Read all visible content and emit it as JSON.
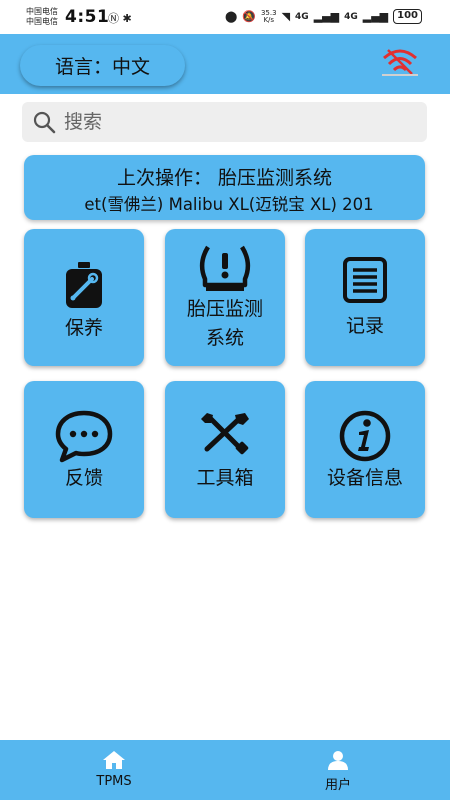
{
  "status_bar": {
    "carrier_1": "中国电信",
    "carrier_2": "中国电信",
    "time": "4:51",
    "speed_value": "35.3",
    "speed_unit": "K/s",
    "network_1": "4G",
    "network_2": "4G",
    "battery": "100"
  },
  "header": {
    "language_label": "语言：中文"
  },
  "search": {
    "placeholder": "搜索"
  },
  "last_operation": {
    "title": "上次操作：  胎压监测系统",
    "vehicle": "et(雪佛兰) Malibu XL(迈锐宝 XL) 201"
  },
  "tiles": [
    {
      "label": "保养",
      "icon": "maintenance-icon"
    },
    {
      "label_line1": "胎压监测",
      "label_line2": "系统",
      "icon": "tire-pressure-icon"
    },
    {
      "label": "记录",
      "icon": "record-icon"
    },
    {
      "label": "反馈",
      "icon": "feedback-icon"
    },
    {
      "label": "工具箱",
      "icon": "toolbox-icon"
    },
    {
      "label": "设备信息",
      "icon": "info-icon"
    }
  ],
  "bottom_nav": [
    {
      "label": "TPMS",
      "icon": "home-icon"
    },
    {
      "label": "用户",
      "icon": "user-icon"
    }
  ],
  "colors": {
    "primary": "#56b7ef",
    "icon_dark": "#111111",
    "wifi_off": "#e03030"
  }
}
